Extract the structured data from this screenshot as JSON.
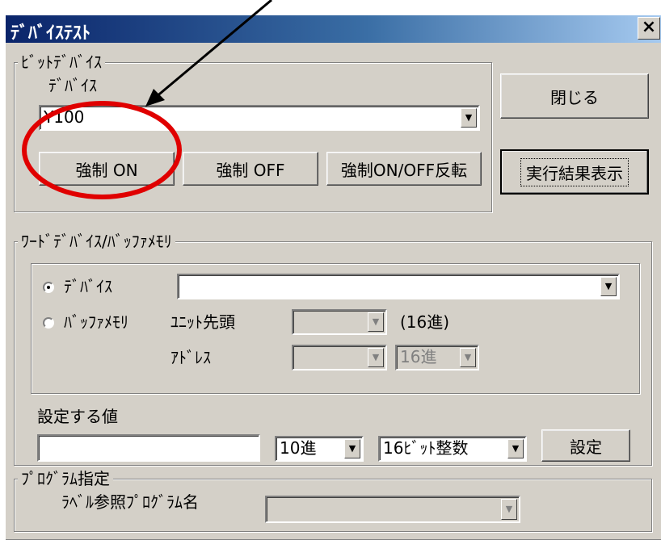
{
  "window": {
    "title": "ﾃﾞﾊﾞｲｽﾃｽﾄ",
    "close_label": "×"
  },
  "bit_device": {
    "group_label": "ﾋﾞｯﾄﾃﾞﾊﾞｲｽ",
    "device_label": "ﾃﾞﾊﾞｲｽ",
    "device_value": "Y100",
    "force_on": "強制 ON",
    "force_off": "強制 OFF",
    "force_toggle": "強制ON/OFF反転"
  },
  "close_button": "閉じる",
  "show_result_button": "実行結果表示",
  "word_device": {
    "group_label": "ﾜｰﾄﾞﾃﾞﾊﾞｲｽ/ﾊﾞｯﾌｧﾒﾓﾘ",
    "radio_device": "ﾃﾞﾊﾞｲｽ",
    "radio_buffer": "ﾊﾞｯﾌｧﾒﾓﾘ",
    "radio_selected": "device",
    "device_value": "",
    "unit_head_label": "ﾕﾆｯﾄ先頭",
    "unit_head_value": "",
    "unit_hex_note": "(16進)",
    "address_label": "ｱﾄﾞﾚｽ",
    "address_value": "",
    "address_base": "16進"
  },
  "set_value": {
    "label": "設定する値",
    "value": "",
    "radix": "10進",
    "data_type": "16ﾋﾞｯﾄ整数",
    "set_button": "設定"
  },
  "program": {
    "group_label": "ﾌﾟﾛｸﾞﾗﾑ指定",
    "label_ref": "ﾗﾍﾞﾙ参照ﾌﾟﾛｸﾞﾗﾑ名",
    "value": ""
  },
  "annotation": {
    "highlight_color": "#e00000",
    "arrow_color": "#000000"
  },
  "icons": {
    "dropdown": "▼"
  }
}
